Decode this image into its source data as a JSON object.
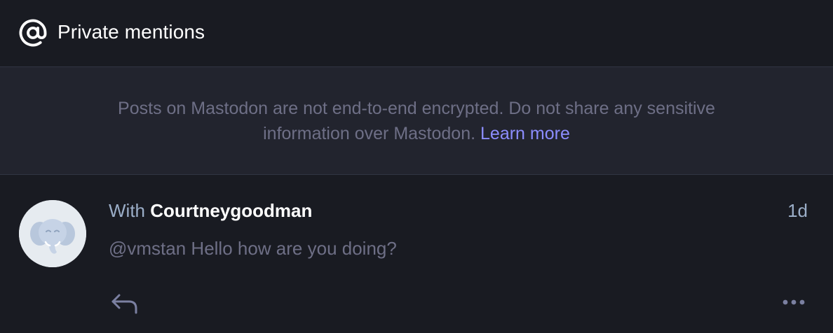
{
  "header": {
    "icon": "at-sign-icon",
    "title": "Private mentions"
  },
  "notice": {
    "text": "Posts on Mastodon are not end-to-end encrypted. Do not share any sensitive information over Mastodon.",
    "link_label": "Learn more"
  },
  "conversation": {
    "avatar_icon": "mastodon-elephant-avatar",
    "with_prefix": "With",
    "participant": "Courtneygoodman",
    "timestamp": "1d",
    "preview": "@vmstan Hello how are you doing?",
    "actions": {
      "reply_icon": "reply-icon",
      "more_icon": "more-options-icon"
    }
  },
  "colors": {
    "background": "#191b22",
    "notice_background": "#22242e",
    "link": "#8c8dff",
    "muted_text": "#6e6f86",
    "secondary_text": "#9baec8"
  }
}
